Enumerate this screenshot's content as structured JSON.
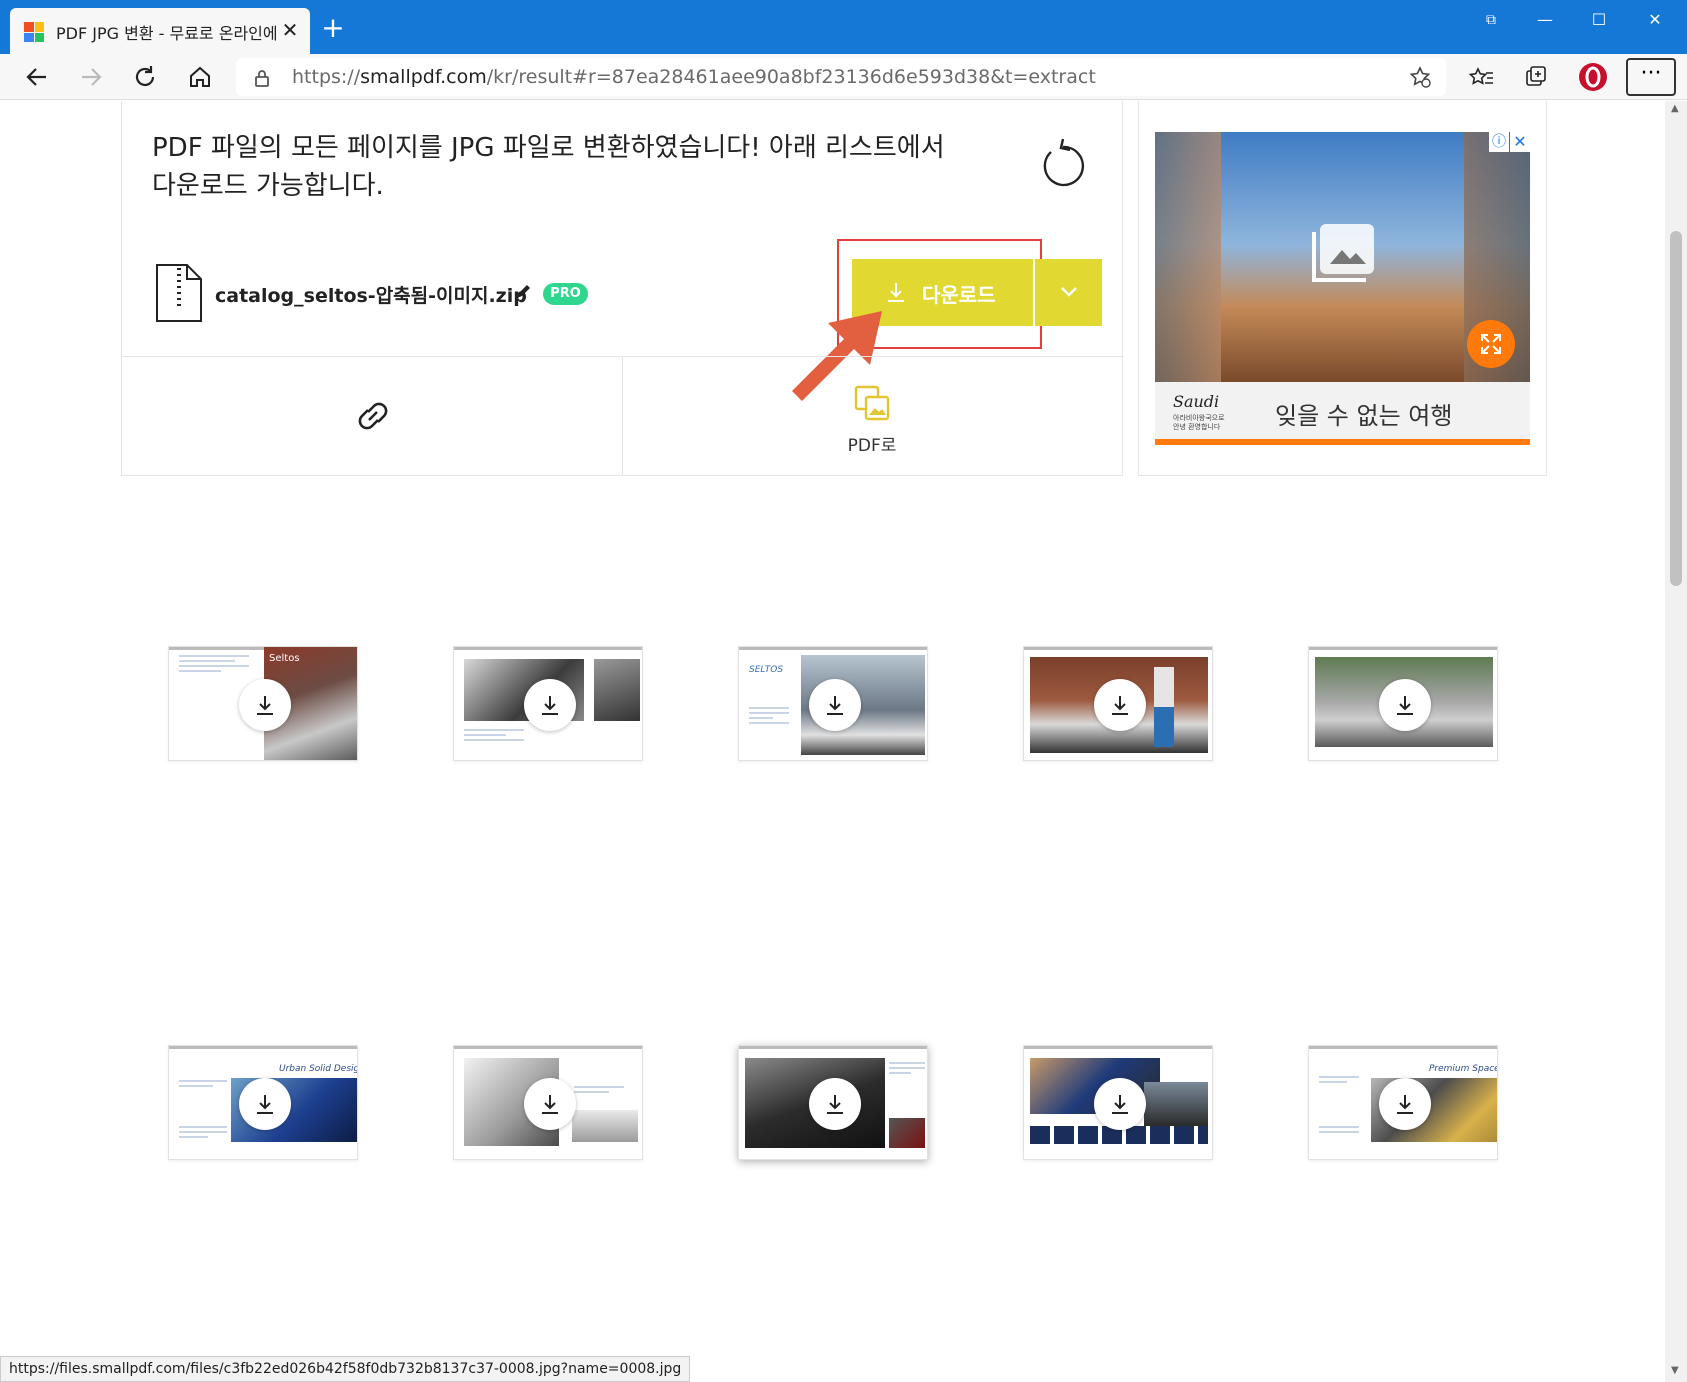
{
  "tab": {
    "title": "PDF JPG 변환 - 무료로 온라인에서",
    "close": "✕"
  },
  "new_tab_label": "+",
  "window_controls": {
    "collections": "⧉",
    "minimize": "—",
    "maximize": "☐",
    "close": "✕"
  },
  "address_bar": {
    "url_prefix": "https://",
    "url_host": "smallpdf.com",
    "url_path": "/kr/result#r=87ea28461aee90a8bf23136d6e593d38&t=extract"
  },
  "more_menu": "···",
  "result": {
    "message": "PDF 파일의 모든 페이지를 JPG 파일로 변환하였습니다! 아래 리스트에서 다운로드 가능합니다.",
    "file_name": "catalog_seltos-압축됨-이미지.zip",
    "pro_badge": "PRO",
    "download_label": "다운로드",
    "to_pdf_label": "PDF로"
  },
  "ad": {
    "info": "ⓘ",
    "close": "✕",
    "brand": "Saudi",
    "brand_sub": "아라비아왕국으로 안녕 환영합니다",
    "tagline": "잊을 수 없는 여행"
  },
  "thumbnails": [
    {
      "caption": "Seltos"
    },
    {
      "caption": ""
    },
    {
      "caption": "SELTOS"
    },
    {
      "caption": ""
    },
    {
      "caption": ""
    },
    {
      "caption": "Urban Solid Design"
    },
    {
      "caption": ""
    },
    {
      "caption": ""
    },
    {
      "caption": ""
    },
    {
      "caption": "Premium Space"
    }
  ],
  "status_bar": {
    "url": "https://files.smallpdf.com/files/c3fb22ed026b42f58f0db732b8137c37-0008.jpg?name=0008.jpg"
  },
  "colors": {
    "titlebar": "#1577d6",
    "download_button": "#e2d832",
    "pro_badge": "#2fd68d",
    "highlight": "#e33f3f",
    "annotation_arrow": "#e2603f",
    "ad_accent": "#ff7a0a"
  }
}
